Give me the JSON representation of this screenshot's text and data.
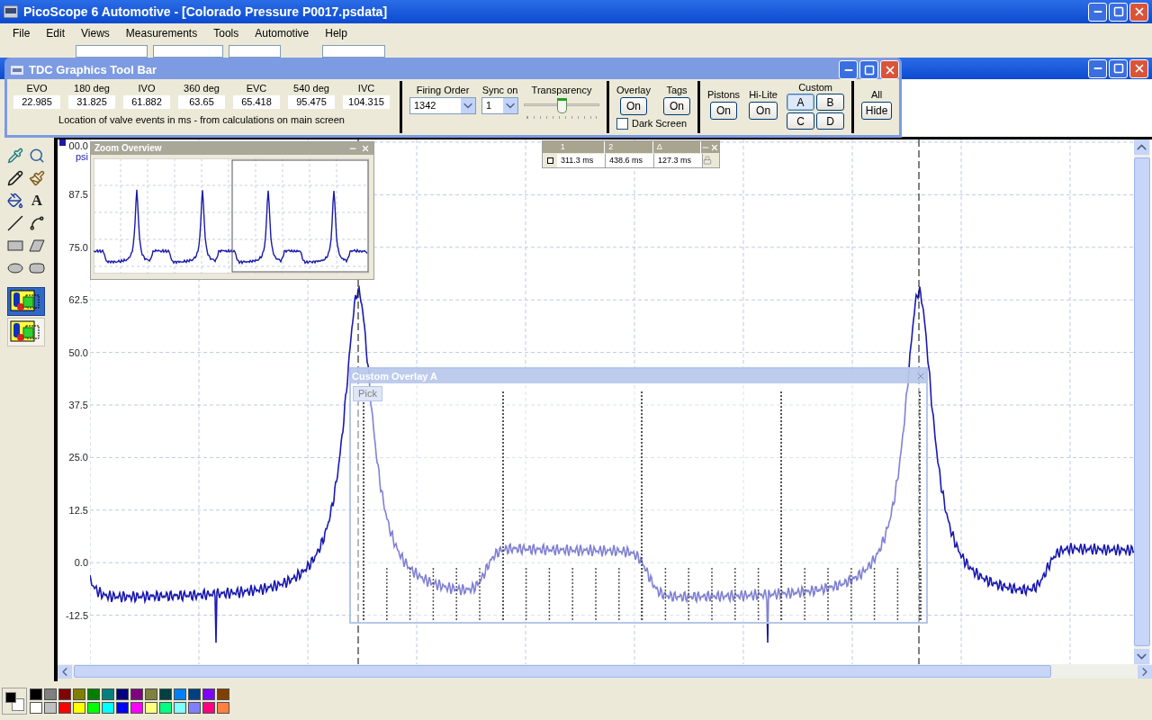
{
  "window": {
    "title": "PicoScope 6 Automotive - [Colorado Pressure P0017.psdata]"
  },
  "menu": [
    "File",
    "Edit",
    "Views",
    "Measurements",
    "Tools",
    "Automotive",
    "Help"
  ],
  "tdc_toolbar": {
    "title": "TDC Graphics Tool Bar",
    "events": [
      {
        "label": "EVO",
        "value": "22.985"
      },
      {
        "label": "180 deg",
        "value": "31.825"
      },
      {
        "label": "IVO",
        "value": "61.882"
      },
      {
        "label": "360 deg",
        "value": "63.65"
      },
      {
        "label": "EVC",
        "value": "65.418"
      },
      {
        "label": "540 deg",
        "value": "95.475"
      },
      {
        "label": "IVC",
        "value": "104.315"
      }
    ],
    "caption": "Location of valve events in ms - from calculations on main screen",
    "firing_order": {
      "label": "Firing Order",
      "value": "1342"
    },
    "sync_on": {
      "label": "Sync on",
      "value": "1"
    },
    "transparency": {
      "label": "Transparency",
      "level": 0.5
    },
    "overlay": {
      "label": "Overlay",
      "button": "On"
    },
    "tags": {
      "label": "Tags",
      "button": "On"
    },
    "dark_screen": {
      "label": "Dark Screen",
      "checked": false
    },
    "pistons": {
      "label": "Pistons",
      "button": "On"
    },
    "hilite": {
      "label": "Hi-Lite",
      "button": "On"
    },
    "custom": {
      "label": "Custom",
      "buttons": [
        {
          "label": "A",
          "selected": true
        },
        {
          "label": "B",
          "selected": false
        },
        {
          "label": "C",
          "selected": false
        },
        {
          "label": "D",
          "selected": false
        }
      ]
    },
    "all": {
      "label": "All",
      "button": "Hide"
    }
  },
  "zoom_overview": {
    "title": "Zoom Overview"
  },
  "measurements": {
    "columns": [
      "1",
      "2",
      "Δ"
    ],
    "values": [
      "311.3 ms",
      "438.6 ms",
      "127.3 ms"
    ],
    "row_checked": false
  },
  "scope": {
    "unit": "psi",
    "y_labels": [
      "00.0",
      "87.5",
      "75.0",
      "62.5",
      "50.0",
      "37.5",
      "25.0",
      "12.5",
      "0.0",
      "-12.5"
    ]
  },
  "overlay": {
    "title": "Custom Overlay A",
    "pick_button": "Pick"
  },
  "tools": {
    "text_tool": "A",
    "view_buttons": [
      {
        "selected": true
      },
      {
        "selected": false
      }
    ]
  },
  "palette": {
    "colors": [
      {
        "color": "#000000"
      },
      {
        "color": "#808080"
      },
      {
        "color": "#800000"
      },
      {
        "color": "#808000"
      },
      {
        "color": "#008000"
      },
      {
        "color": "#008080"
      },
      {
        "color": "#000080"
      },
      {
        "color": "#800080"
      },
      {
        "color": "#808040"
      },
      {
        "color": "#004040"
      },
      {
        "color": "#0080ff"
      },
      {
        "color": "#004080"
      },
      {
        "color": "#8000ff"
      },
      {
        "color": "#804000"
      },
      {
        "color": "#ffffff"
      },
      {
        "color": "#c0c0c0"
      },
      {
        "color": "#ff0000"
      },
      {
        "color": "#ffff00"
      },
      {
        "color": "#00ff00"
      },
      {
        "color": "#00ffff"
      },
      {
        "color": "#0000ff"
      },
      {
        "color": "#ff00ff"
      },
      {
        "color": "#ffff80"
      },
      {
        "color": "#00ff80"
      },
      {
        "color": "#80ffff"
      },
      {
        "color": "#8080ff"
      },
      {
        "color": "#ff0080"
      },
      {
        "color": "#ff8040"
      }
    ]
  }
}
